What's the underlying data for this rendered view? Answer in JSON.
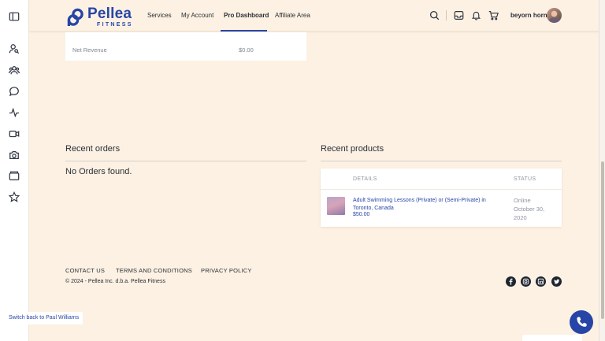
{
  "brand": {
    "name": "Pellea",
    "subtitle": "FITNESS",
    "color": "#2745a6"
  },
  "nav": {
    "items": [
      {
        "label": "Services"
      },
      {
        "label": "My Account"
      },
      {
        "label": "Pro Dashboard",
        "active": true
      },
      {
        "label": "Affiliate Area"
      }
    ]
  },
  "header": {
    "username": "beyorn horn",
    "icons": [
      "search-icon",
      "inbox-icon",
      "bell-icon",
      "cart-icon"
    ]
  },
  "sidebar": {
    "icons": [
      "panel-toggle-icon",
      "user-search-icon",
      "users-icon",
      "chat-icon",
      "activity-icon",
      "video-icon",
      "camera-icon",
      "folder-icon",
      "star-icon"
    ]
  },
  "revenue": {
    "label": "Net Revenue",
    "value": "$0.00"
  },
  "orders": {
    "title": "Recent orders",
    "empty": "No Orders found."
  },
  "products": {
    "title": "Recent products",
    "columns": {
      "details": "DETAILS",
      "status": "STATUS"
    },
    "rows": [
      {
        "title": "Adult Swimming Lessons (Private) or (Semi-Private) in Toronto, Canada",
        "price": "$50.00",
        "status": "Online",
        "date": "October 30, 2020"
      }
    ]
  },
  "footer": {
    "links": [
      "CONTACT US",
      "TERMS AND CONDITIONS",
      "PRIVACY POLICY"
    ],
    "copyright": "© 2024 - Pellea Inc. d.b.a. Pellea Fitness",
    "social": [
      "facebook-icon",
      "instagram-icon",
      "linkedin-icon",
      "twitter-icon"
    ]
  },
  "switch_back": "Switch back to Paul Williams"
}
